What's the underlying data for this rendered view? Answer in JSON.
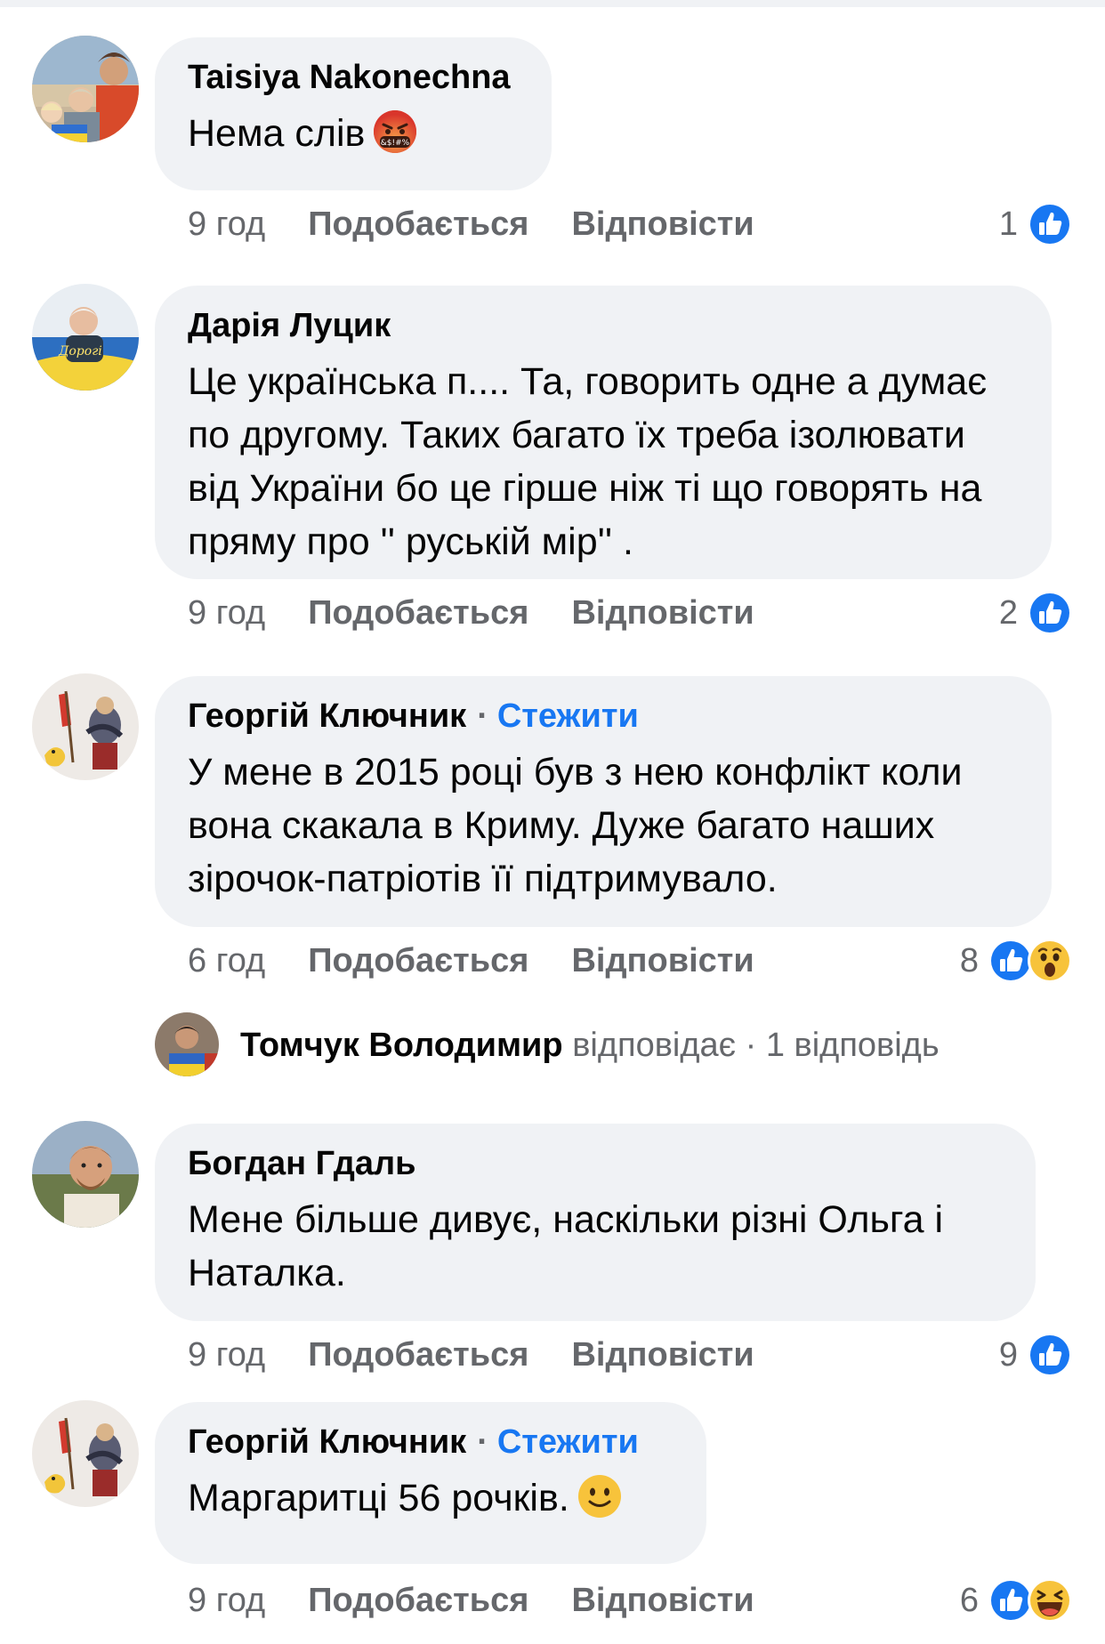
{
  "comments": [
    {
      "author": "Taisiya Nakonechna",
      "text": "Нема слів",
      "text_emoji": "face-with-symbols-on-mouth",
      "time": "9 год",
      "like_label": "Подобається",
      "reply_label": "Відповісти",
      "reaction_count": "1",
      "reactions": [
        "like-icon"
      ]
    },
    {
      "author": "Дарія Луцик",
      "text": "Це українська п.... Та, говорить одне а думає по другому. Таких багато їх треба ізолювати від України бо це гірше ніж ті що говорять на пряму про '' руській мір'' .",
      "time": "9 год",
      "like_label": "Подобається",
      "reply_label": "Відповісти",
      "reaction_count": "2",
      "reactions": [
        "like-icon"
      ]
    },
    {
      "author": "Георгій Ключник",
      "follow_sep": "·",
      "follow_label": "Стежити",
      "text": "У мене в 2015 році був з нею конфлікт коли вона скакала в Криму. Дуже багато наших зірочок-патріотів її підтримувало.",
      "time": "6 год",
      "like_label": "Подобається",
      "reply_label": "Відповісти",
      "reaction_count": "8",
      "reactions": [
        "like-icon",
        "wow-icon"
      ],
      "replies": {
        "author": "Томчук Володимир",
        "verb": "відповідає",
        "sep": "·",
        "count_label": "1 відповідь"
      }
    },
    {
      "author": "Богдан Гдаль",
      "text": "Мене більше дивує, наскільки різні Ольга і Наталка.",
      "time": "9 год",
      "like_label": "Подобається",
      "reply_label": "Відповісти",
      "reaction_count": "9",
      "reactions": [
        "like-icon"
      ]
    },
    {
      "author": "Георгій Ключник",
      "follow_sep": "·",
      "follow_label": "Стежити",
      "text": "Маргаритці 56 рочків.",
      "text_emoji": "slightly-smiling-face",
      "time": "9 год",
      "like_label": "Подобається",
      "reply_label": "Відповісти",
      "reaction_count": "6",
      "reactions": [
        "like-icon",
        "haha-icon"
      ]
    }
  ],
  "colors": {
    "bubble": "#f0f2f5",
    "meta_text": "#65676b",
    "follow_link": "#1877f2",
    "like_blue": "#1877f2"
  }
}
